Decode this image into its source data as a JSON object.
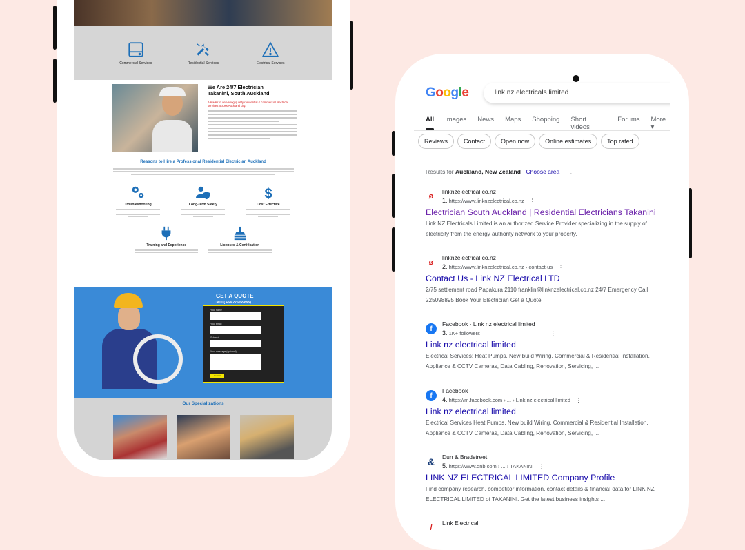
{
  "left_phone": {
    "services": [
      {
        "label": "Commercial Services",
        "icon": "hard-drive-icon"
      },
      {
        "label": "Residential Services",
        "icon": "tools-icon"
      },
      {
        "label": "Electrical Services",
        "icon": "warning-icon"
      }
    ],
    "about": {
      "heading_line1": "We Are 24/7 Electrician",
      "heading_line2": "Takanini, South Auckland",
      "tagline": "A leader in delivering quality residential & commercial electrical services across Auckland city."
    },
    "reasons_title": "Reasons to Hire a Professional Residential Electrician Auckland",
    "features": [
      {
        "title": "Troubleshooting",
        "icon": "gears-icon"
      },
      {
        "title": "Long-term Safety",
        "icon": "user-shield-icon"
      },
      {
        "title": "Cost Effective",
        "icon": "dollar-icon"
      },
      {
        "title": "Training and Experience",
        "icon": "plug-icon"
      },
      {
        "title": "Licenses & Certification",
        "icon": "stamp-icon"
      }
    ],
    "quote": {
      "title": "GET A QUOTE",
      "call": "CALL( +64 225059895)",
      "fields": [
        "Your name",
        "Your email",
        "Subject",
        "Your message (optional)"
      ],
      "submit": "Submit"
    },
    "specializations_title": "Our Specializations"
  },
  "google": {
    "logo_letters": [
      "G",
      "o",
      "o",
      "g",
      "l",
      "e"
    ],
    "logo_colors": [
      "#4285F4",
      "#EA4335",
      "#FBBC05",
      "#4285F4",
      "#34A853",
      "#EA4335"
    ],
    "query": "link nz electricals limited",
    "tabs": [
      "All",
      "Images",
      "News",
      "Maps",
      "Shopping",
      "Short videos",
      "Forums",
      "More ▾"
    ],
    "chips": [
      "Reviews",
      "Contact",
      "Open now",
      "Online estimates",
      "Top rated"
    ],
    "results_for_prefix": "Results for ",
    "results_for_location": "Auckland, New Zealand",
    "choose_area": " · Choose area",
    "results": [
      {
        "site": "linknzelectrical.co.nz",
        "num": "1.",
        "url": "https://www.linknzelectrical.co.nz",
        "title": "Electrician South Auckland | Residential Electricians Takanini",
        "snippet1": "Link NZ Electricals Limited is an authorized Service Provider specializing in the supply of",
        "snippet2": "electricity from the energy authority network to your property."
      },
      {
        "site": "linknzelectrical.co.nz",
        "num": "2.",
        "url": "https://www.linknzelectrical.co.nz › contact-us",
        "title": "Contact Us - Link NZ Electrical LTD",
        "snippet1": "2/75 settlement road Papakura 2110 franklin@linknzelectrical.co.nz 24/7 Emergency Call",
        "snippet2": "225098895 Book Your Electrician Get a Quote"
      },
      {
        "site": "Facebook · Link nz electrical limited",
        "num": "3.",
        "url": "1K+ followers",
        "title": "Link nz electrical limited",
        "snippet1": "Electrical Services: Heat Pumps, New build Wiring, Commercial & Residential Installation,",
        "snippet2": "Appliance & CCTV Cameras, Data Cabling, Renovation, Servicing, ..."
      },
      {
        "site": "Facebook",
        "num": "4.",
        "url": "https://m.facebook.com › ... › Link nz electrical limited",
        "title": "Link nz electrical limited",
        "snippet1": "Electrical Services Heat Pumps, New build Wiring, Commercial & Residential Installation,",
        "snippet2": "Appliance & CCTV Cameras, Data Cabling, Renovation, Servicing, ..."
      },
      {
        "site": "Dun & Bradstreet",
        "num": "5.",
        "url": "https://www.dnb.com › ... › TAKANINI",
        "title": "LINK NZ ELECTRICAL LIMITED Company Profile",
        "snippet1": "Find company research, competitor information, contact details & financial data for LINK NZ",
        "snippet2": "ELECTRICAL LIMITED of TAKANINI. Get the latest business insights ..."
      },
      {
        "site": "Link Electrical",
        "num": "",
        "url": "",
        "title": "",
        "snippet1": "",
        "snippet2": ""
      }
    ],
    "more_options": "⋮"
  }
}
